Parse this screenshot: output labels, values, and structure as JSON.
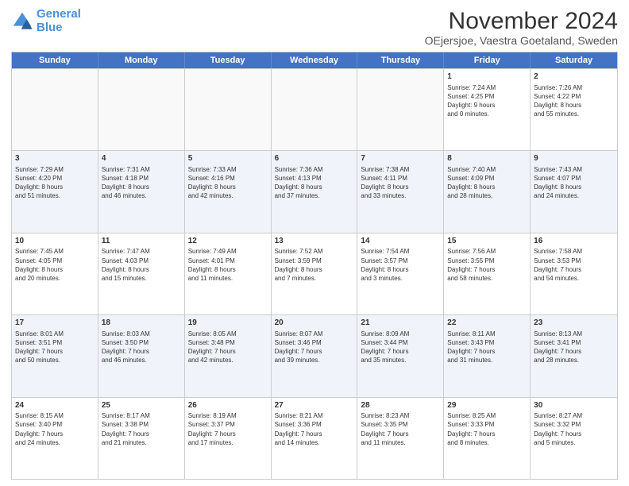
{
  "logo": {
    "line1": "General",
    "line2": "Blue"
  },
  "title": "November 2024",
  "location": "OEjersjoe, Vaestra Goetaland, Sweden",
  "header_days": [
    "Sunday",
    "Monday",
    "Tuesday",
    "Wednesday",
    "Thursday",
    "Friday",
    "Saturday"
  ],
  "weeks": [
    [
      {
        "day": "",
        "info": "",
        "empty": true
      },
      {
        "day": "",
        "info": "",
        "empty": true
      },
      {
        "day": "",
        "info": "",
        "empty": true
      },
      {
        "day": "",
        "info": "",
        "empty": true
      },
      {
        "day": "",
        "info": "",
        "empty": true
      },
      {
        "day": "1",
        "info": "Sunrise: 7:24 AM\nSunset: 4:25 PM\nDaylight: 9 hours\nand 0 minutes."
      },
      {
        "day": "2",
        "info": "Sunrise: 7:26 AM\nSunset: 4:22 PM\nDaylight: 8 hours\nand 55 minutes."
      }
    ],
    [
      {
        "day": "3",
        "info": "Sunrise: 7:29 AM\nSunset: 4:20 PM\nDaylight: 8 hours\nand 51 minutes."
      },
      {
        "day": "4",
        "info": "Sunrise: 7:31 AM\nSunset: 4:18 PM\nDaylight: 8 hours\nand 46 minutes."
      },
      {
        "day": "5",
        "info": "Sunrise: 7:33 AM\nSunset: 4:16 PM\nDaylight: 8 hours\nand 42 minutes."
      },
      {
        "day": "6",
        "info": "Sunrise: 7:36 AM\nSunset: 4:13 PM\nDaylight: 8 hours\nand 37 minutes."
      },
      {
        "day": "7",
        "info": "Sunrise: 7:38 AM\nSunset: 4:11 PM\nDaylight: 8 hours\nand 33 minutes."
      },
      {
        "day": "8",
        "info": "Sunrise: 7:40 AM\nSunset: 4:09 PM\nDaylight: 8 hours\nand 28 minutes."
      },
      {
        "day": "9",
        "info": "Sunrise: 7:43 AM\nSunset: 4:07 PM\nDaylight: 8 hours\nand 24 minutes."
      }
    ],
    [
      {
        "day": "10",
        "info": "Sunrise: 7:45 AM\nSunset: 4:05 PM\nDaylight: 8 hours\nand 20 minutes."
      },
      {
        "day": "11",
        "info": "Sunrise: 7:47 AM\nSunset: 4:03 PM\nDaylight: 8 hours\nand 15 minutes."
      },
      {
        "day": "12",
        "info": "Sunrise: 7:49 AM\nSunset: 4:01 PM\nDaylight: 8 hours\nand 11 minutes."
      },
      {
        "day": "13",
        "info": "Sunrise: 7:52 AM\nSunset: 3:59 PM\nDaylight: 8 hours\nand 7 minutes."
      },
      {
        "day": "14",
        "info": "Sunrise: 7:54 AM\nSunset: 3:57 PM\nDaylight: 8 hours\nand 3 minutes."
      },
      {
        "day": "15",
        "info": "Sunrise: 7:56 AM\nSunset: 3:55 PM\nDaylight: 7 hours\nand 58 minutes."
      },
      {
        "day": "16",
        "info": "Sunrise: 7:58 AM\nSunset: 3:53 PM\nDaylight: 7 hours\nand 54 minutes."
      }
    ],
    [
      {
        "day": "17",
        "info": "Sunrise: 8:01 AM\nSunset: 3:51 PM\nDaylight: 7 hours\nand 50 minutes."
      },
      {
        "day": "18",
        "info": "Sunrise: 8:03 AM\nSunset: 3:50 PM\nDaylight: 7 hours\nand 46 minutes."
      },
      {
        "day": "19",
        "info": "Sunrise: 8:05 AM\nSunset: 3:48 PM\nDaylight: 7 hours\nand 42 minutes."
      },
      {
        "day": "20",
        "info": "Sunrise: 8:07 AM\nSunset: 3:46 PM\nDaylight: 7 hours\nand 39 minutes."
      },
      {
        "day": "21",
        "info": "Sunrise: 8:09 AM\nSunset: 3:44 PM\nDaylight: 7 hours\nand 35 minutes."
      },
      {
        "day": "22",
        "info": "Sunrise: 8:11 AM\nSunset: 3:43 PM\nDaylight: 7 hours\nand 31 minutes."
      },
      {
        "day": "23",
        "info": "Sunrise: 8:13 AM\nSunset: 3:41 PM\nDaylight: 7 hours\nand 28 minutes."
      }
    ],
    [
      {
        "day": "24",
        "info": "Sunrise: 8:15 AM\nSunset: 3:40 PM\nDaylight: 7 hours\nand 24 minutes."
      },
      {
        "day": "25",
        "info": "Sunrise: 8:17 AM\nSunset: 3:38 PM\nDaylight: 7 hours\nand 21 minutes."
      },
      {
        "day": "26",
        "info": "Sunrise: 8:19 AM\nSunset: 3:37 PM\nDaylight: 7 hours\nand 17 minutes."
      },
      {
        "day": "27",
        "info": "Sunrise: 8:21 AM\nSunset: 3:36 PM\nDaylight: 7 hours\nand 14 minutes."
      },
      {
        "day": "28",
        "info": "Sunrise: 8:23 AM\nSunset: 3:35 PM\nDaylight: 7 hours\nand 11 minutes."
      },
      {
        "day": "29",
        "info": "Sunrise: 8:25 AM\nSunset: 3:33 PM\nDaylight: 7 hours\nand 8 minutes."
      },
      {
        "day": "30",
        "info": "Sunrise: 8:27 AM\nSunset: 3:32 PM\nDaylight: 7 hours\nand 5 minutes."
      }
    ]
  ]
}
